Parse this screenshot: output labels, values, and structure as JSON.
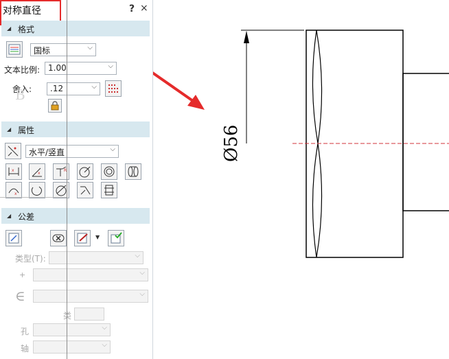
{
  "titlebar": {
    "title": "对称直径",
    "help": "?",
    "close": "×"
  },
  "format": {
    "header": "格式",
    "standard": "国标",
    "scale_label": "文本比例:",
    "scale_value": "1.00",
    "round_label": "舍入:",
    "round_value": ".12"
  },
  "properties": {
    "header": "属性",
    "orientation": "水平/竖直"
  },
  "tolerance": {
    "header": "公差",
    "type_label": "类型(T):",
    "plus_label": "+",
    "epsilon_label": "∈",
    "class_label": "类",
    "hole_label": "孔",
    "shaft_label": "轴"
  },
  "drawing": {
    "dimension_label": "Ø56"
  },
  "colors": {
    "accent_red": "#e52b2b",
    "section_bg": "#d7e8ef",
    "centerline": "#d0303a"
  }
}
